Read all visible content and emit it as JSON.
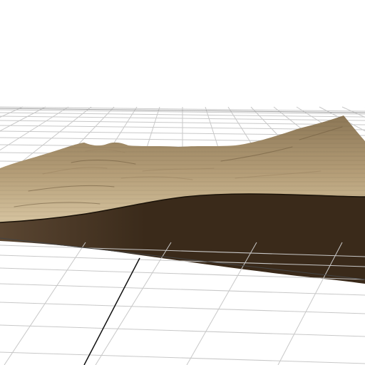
{
  "viewport": {
    "background_color": "#ffffff",
    "grid_color": "#c8c8c8",
    "grid_major_color": "#111111"
  },
  "terrain": {
    "top_surface_color": "#b59e78",
    "top_surface_light_color": "#d6c4a0",
    "top_surface_dark_color": "#8c7756",
    "side_wall_color": "#3a2a1a",
    "side_wall_light_color": "#5a4632"
  }
}
